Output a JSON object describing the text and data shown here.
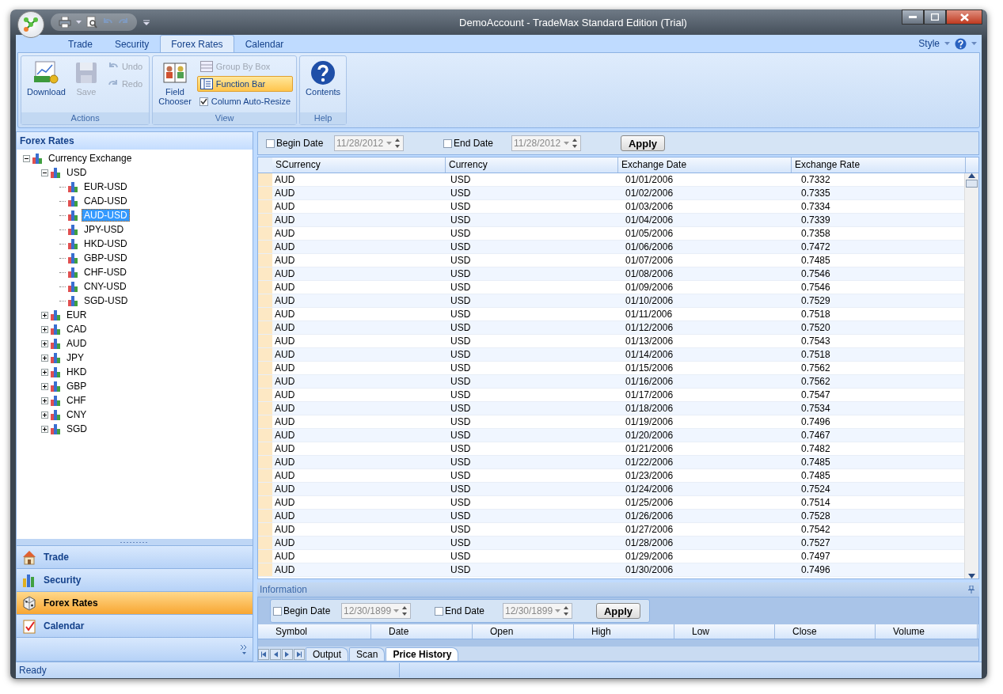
{
  "window": {
    "title": "DemoAccount - TradeMax Standard Edition (Trial)"
  },
  "ribbon": {
    "tabs": [
      {
        "label": "Trade",
        "selected": false
      },
      {
        "label": "Security",
        "selected": false
      },
      {
        "label": "Forex Rates",
        "selected": true
      },
      {
        "label": "Calendar",
        "selected": false
      }
    ],
    "style_menu": "Style",
    "groups": [
      {
        "title": "Actions",
        "items": [
          {
            "kind": "large",
            "label": "Download",
            "disabled": false
          },
          {
            "kind": "large",
            "label": "Save",
            "disabled": true
          },
          {
            "kind": "small",
            "label": "Undo",
            "disabled": true
          },
          {
            "kind": "small",
            "label": "Redo",
            "disabled": true
          }
        ]
      },
      {
        "title": "View",
        "items": [
          {
            "kind": "large",
            "label": "Field Chooser",
            "disabled": false
          },
          {
            "kind": "small",
            "label": "Group By Box",
            "disabled": true,
            "pressed": false
          },
          {
            "kind": "small",
            "label": "Function Bar",
            "disabled": false,
            "pressed": true
          },
          {
            "kind": "check",
            "label": "Column Auto-Resize",
            "checked": true
          }
        ]
      },
      {
        "title": "Help",
        "items": [
          {
            "kind": "large",
            "label": "Contents",
            "disabled": false
          }
        ]
      }
    ]
  },
  "navigator": {
    "title": "Forex Rates",
    "tree": [
      {
        "label": "Currency Exchange",
        "expanded": true,
        "children": [
          {
            "label": "USD",
            "expanded": true,
            "children": [
              {
                "label": "EUR-USD",
                "selected": false
              },
              {
                "label": "CAD-USD",
                "selected": false
              },
              {
                "label": "AUD-USD",
                "selected": true
              },
              {
                "label": "JPY-USD",
                "selected": false
              },
              {
                "label": "HKD-USD",
                "selected": false
              },
              {
                "label": "GBP-USD",
                "selected": false
              },
              {
                "label": "CHF-USD",
                "selected": false
              },
              {
                "label": "CNY-USD",
                "selected": false
              },
              {
                "label": "SGD-USD",
                "selected": false
              }
            ]
          },
          {
            "label": "EUR",
            "expanded": false
          },
          {
            "label": "CAD",
            "expanded": false
          },
          {
            "label": "AUD",
            "expanded": false
          },
          {
            "label": "JPY",
            "expanded": false
          },
          {
            "label": "HKD",
            "expanded": false
          },
          {
            "label": "GBP",
            "expanded": false
          },
          {
            "label": "CHF",
            "expanded": false
          },
          {
            "label": "CNY",
            "expanded": false
          },
          {
            "label": "SGD",
            "expanded": false
          }
        ]
      }
    ],
    "sections": [
      {
        "label": "Trade",
        "selected": false
      },
      {
        "label": "Security",
        "selected": false
      },
      {
        "label": "Forex Rates",
        "selected": true
      },
      {
        "label": "Calendar",
        "selected": false
      }
    ]
  },
  "rates": {
    "filter": {
      "begin": {
        "label": "Begin Date",
        "checked": false,
        "value": "11/28/2012",
        "disabled": true
      },
      "end": {
        "label": "End Date",
        "checked": false,
        "value": "11/28/2012",
        "disabled": true
      },
      "apply": "Apply"
    },
    "columns": [
      "SCurrency",
      "Currency",
      "Exchange Date",
      "Exchange Rate"
    ],
    "rows": [
      [
        "AUD",
        "USD",
        "01/01/2006",
        "0.7332"
      ],
      [
        "AUD",
        "USD",
        "01/02/2006",
        "0.7335"
      ],
      [
        "AUD",
        "USD",
        "01/03/2006",
        "0.7334"
      ],
      [
        "AUD",
        "USD",
        "01/04/2006",
        "0.7339"
      ],
      [
        "AUD",
        "USD",
        "01/05/2006",
        "0.7358"
      ],
      [
        "AUD",
        "USD",
        "01/06/2006",
        "0.7472"
      ],
      [
        "AUD",
        "USD",
        "01/07/2006",
        "0.7485"
      ],
      [
        "AUD",
        "USD",
        "01/08/2006",
        "0.7546"
      ],
      [
        "AUD",
        "USD",
        "01/09/2006",
        "0.7546"
      ],
      [
        "AUD",
        "USD",
        "01/10/2006",
        "0.7529"
      ],
      [
        "AUD",
        "USD",
        "01/11/2006",
        "0.7518"
      ],
      [
        "AUD",
        "USD",
        "01/12/2006",
        "0.7520"
      ],
      [
        "AUD",
        "USD",
        "01/13/2006",
        "0.7543"
      ],
      [
        "AUD",
        "USD",
        "01/14/2006",
        "0.7518"
      ],
      [
        "AUD",
        "USD",
        "01/15/2006",
        "0.7562"
      ],
      [
        "AUD",
        "USD",
        "01/16/2006",
        "0.7562"
      ],
      [
        "AUD",
        "USD",
        "01/17/2006",
        "0.7547"
      ],
      [
        "AUD",
        "USD",
        "01/18/2006",
        "0.7534"
      ],
      [
        "AUD",
        "USD",
        "01/19/2006",
        "0.7496"
      ],
      [
        "AUD",
        "USD",
        "01/20/2006",
        "0.7467"
      ],
      [
        "AUD",
        "USD",
        "01/21/2006",
        "0.7482"
      ],
      [
        "AUD",
        "USD",
        "01/22/2006",
        "0.7485"
      ],
      [
        "AUD",
        "USD",
        "01/23/2006",
        "0.7485"
      ],
      [
        "AUD",
        "USD",
        "01/24/2006",
        "0.7524"
      ],
      [
        "AUD",
        "USD",
        "01/25/2006",
        "0.7514"
      ],
      [
        "AUD",
        "USD",
        "01/26/2006",
        "0.7528"
      ],
      [
        "AUD",
        "USD",
        "01/27/2006",
        "0.7542"
      ],
      [
        "AUD",
        "USD",
        "01/28/2006",
        "0.7527"
      ],
      [
        "AUD",
        "USD",
        "01/29/2006",
        "0.7497"
      ],
      [
        "AUD",
        "USD",
        "01/30/2006",
        "0.7496"
      ]
    ]
  },
  "information": {
    "title": "Information",
    "filter": {
      "begin": {
        "label": "Begin Date",
        "checked": false,
        "value": "12/30/1899",
        "disabled": true
      },
      "end": {
        "label": "End Date",
        "checked": false,
        "value": "12/30/1899",
        "disabled": true
      },
      "apply": "Apply"
    },
    "columns": [
      "Symbol",
      "Date",
      "Open",
      "High",
      "Low",
      "Close",
      "Volume"
    ],
    "tabs": [
      {
        "label": "Output",
        "selected": false
      },
      {
        "label": "Scan",
        "selected": false
      },
      {
        "label": "Price History",
        "selected": true
      }
    ]
  },
  "status_bar": {
    "text": "Ready"
  }
}
